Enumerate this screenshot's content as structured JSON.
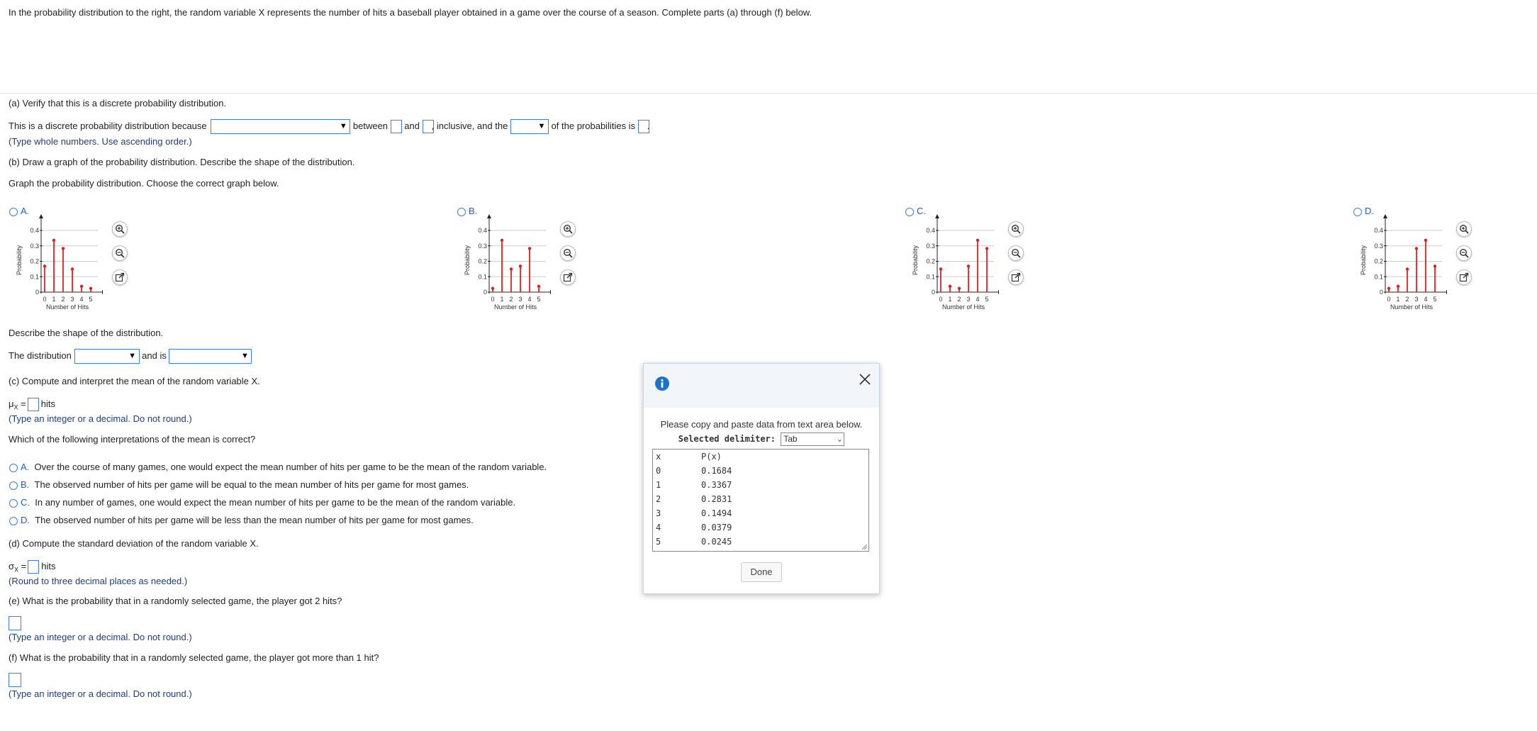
{
  "intro": "In the probability distribution to the right, the random variable X represents the number of hits a baseball player obtained in a game over the course of a season. Complete parts (a) through (f) below.",
  "part_a": {
    "heading": "(a) Verify that this is a discrete probability distribution.",
    "sentence_start": "This is a discrete probability distribution because",
    "between": "between",
    "and": "and",
    "inclusive": ", inclusive, and the",
    "of_the_probs": "of the probabilities is",
    "end": ".",
    "hint": "(Type whole numbers. Use ascending order.)"
  },
  "part_b": {
    "heading": "(b) Draw a graph of the probability distribution. Describe the shape of the distribution.",
    "instruction": "Graph the probability distribution. Choose the correct graph below.",
    "options": [
      {
        "label": "A.",
        "values": [
          0.1684,
          0.3367,
          0.2831,
          0.1494,
          0.0379,
          0.0245
        ]
      },
      {
        "label": "B.",
        "values": [
          0.0245,
          0.3367,
          0.1494,
          0.1684,
          0.2831,
          0.0379
        ]
      },
      {
        "label": "C.",
        "values": [
          0.1494,
          0.0379,
          0.0245,
          0.1684,
          0.3367,
          0.2831
        ]
      },
      {
        "label": "D.",
        "values": [
          0.0245,
          0.0379,
          0.1494,
          0.2831,
          0.3367,
          0.1684
        ]
      }
    ],
    "graph_xlabel": "Number of Hits",
    "graph_ylabel": "Probability",
    "graph_yticks": [
      "0.4",
      "0.3",
      "0.2",
      "0.1",
      "0"
    ],
    "graph_xticks": [
      "0",
      "1",
      "2",
      "3",
      "4",
      "5"
    ],
    "describe_label": "Describe the shape of the distribution.",
    "dist_start": "The distribution",
    "dist_and_is": "and is"
  },
  "part_c": {
    "heading": "(c) Compute and interpret the mean of the random variable X.",
    "mu_label": "μ",
    "mu_sub": "X",
    "equals": "=",
    "unit": "hits",
    "hint": "(Type an integer or a decimal. Do not round.)",
    "question": "Which of the following interpretations of the mean is correct?",
    "choices": [
      {
        "letter": "A.",
        "text": "Over the course of many games, one would expect the mean number of hits per game to be the mean of the random variable."
      },
      {
        "letter": "B.",
        "text": "The observed number of hits per game will be equal to the mean number of hits per game for most games."
      },
      {
        "letter": "C.",
        "text": "In any number of games, one would expect the mean number of hits per game to be the mean of the random variable."
      },
      {
        "letter": "D.",
        "text": "The observed number of hits per game will be less than the mean number of hits per game for most games."
      }
    ]
  },
  "part_d": {
    "heading": "(d) Compute the standard deviation of the random variable X.",
    "sigma_label": "σ",
    "sigma_sub": "X",
    "equals": "=",
    "unit": "hits",
    "hint": "(Round to three decimal places as needed.)"
  },
  "part_e": {
    "heading": "(e) What is the probability that in a randomly selected game, the player got 2 hits?",
    "hint": "(Type an integer or a decimal. Do not round.)"
  },
  "part_f": {
    "heading": "(f) What is the probability that in a randomly selected game, the player got more than 1 hit?",
    "hint": "(Type an integer or a decimal. Do not round.)"
  },
  "dialog": {
    "message": "Please copy and paste data from text area below.",
    "delimiter_label": "Selected delimiter:",
    "delimiter_value": "Tab",
    "header": {
      "x": "x",
      "p": "P(x)"
    },
    "rows": [
      {
        "x": "0",
        "p": "0.1684"
      },
      {
        "x": "1",
        "p": "0.3367"
      },
      {
        "x": "2",
        "p": "0.2831"
      },
      {
        "x": "3",
        "p": "0.1494"
      },
      {
        "x": "4",
        "p": "0.0379"
      },
      {
        "x": "5",
        "p": "0.0245"
      }
    ],
    "done_label": "Done"
  },
  "colors": {
    "accent": "#3d7fd9",
    "bar": "#e02020",
    "info": "#1a73c8"
  }
}
